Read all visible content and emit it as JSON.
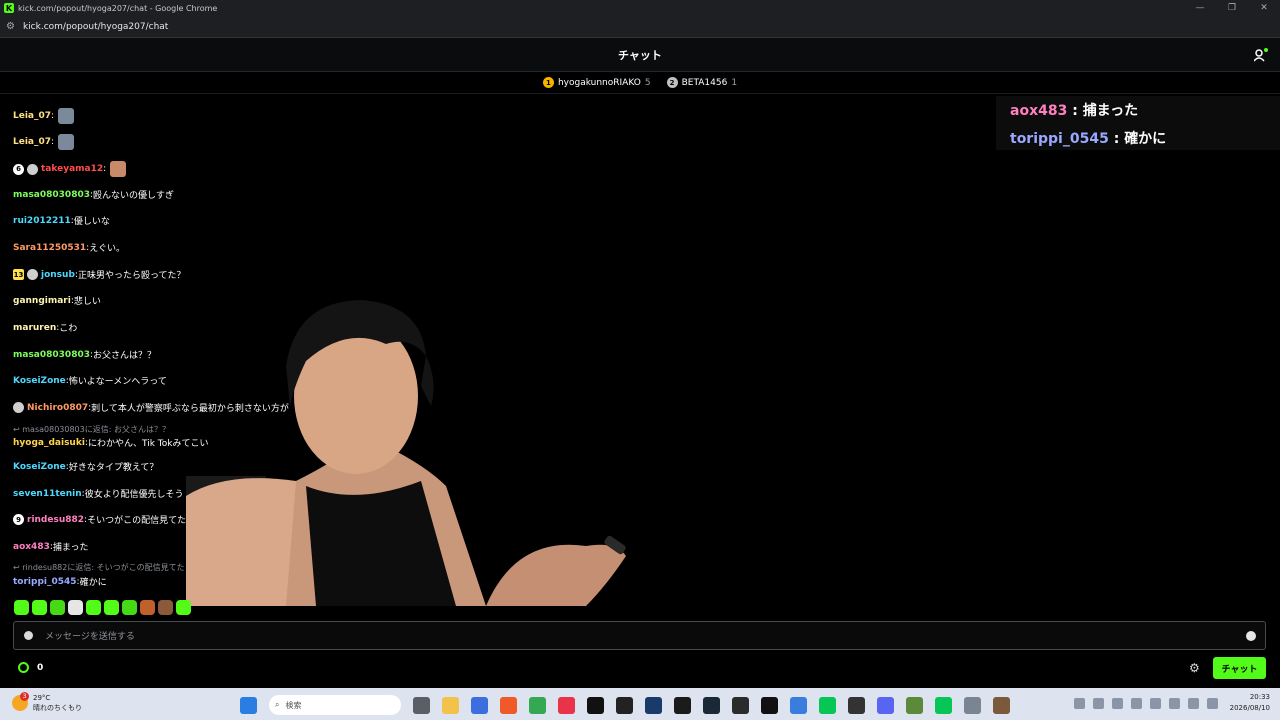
{
  "window": {
    "title": "kick.com/popout/hyoga207/chat - Google Chrome",
    "favicon": "K",
    "controls": [
      "—",
      "❐",
      "✕"
    ]
  },
  "browser": {
    "url": "kick.com/popout/hyoga207/chat"
  },
  "header": {
    "title": "チャット"
  },
  "top_gifters": [
    {
      "name": "hyogakunnoRIAKO",
      "count": "5",
      "color": "#f5b400",
      "medal": "1"
    },
    {
      "name": "BETA1456",
      "count": "1",
      "color": "#c0c0c0",
      "medal": "2"
    }
  ],
  "messages": [
    {
      "user": "Leia_07",
      "color": "#ffe082",
      "text": "",
      "emote": true
    },
    {
      "user": "Leia_07",
      "color": "#ffe082",
      "text": "",
      "emote": true
    },
    {
      "user": "takeyama12",
      "color": "#ff4d4d",
      "text": "",
      "badge": "6",
      "sub": true,
      "emote": true
    },
    {
      "user": "masa08030803",
      "color": "#7cff5a",
      "text": "殴んないの優しすぎ"
    },
    {
      "user": "rui2012211",
      "color": "#4dd9ff",
      "text": "優しいな"
    },
    {
      "user": "Sara11250531",
      "color": "#ff9966",
      "text": "えぐい。"
    },
    {
      "user": "jonsub",
      "color": "#4dd9ff",
      "text": "正味男やったら殴ってた？",
      "badge": "13",
      "badge_square": true,
      "sub": true
    },
    {
      "user": "ganngimari",
      "color": "#fff3b0",
      "text": "悲しい"
    },
    {
      "user": "maruren",
      "color": "#fff3b0",
      "text": "こわ"
    },
    {
      "user": "masa08030803",
      "color": "#7cff5a",
      "text": "お父さんは？？"
    },
    {
      "user": "KoseiZone",
      "color": "#4dd9ff",
      "text": "怖いよなーメンヘラって"
    },
    {
      "user": "Nichiro0807",
      "color": "#ff9966",
      "text": "刺して本人が警察呼ぶなら最初から刺さない方が",
      "sub": true
    },
    {
      "reply": "masa08030803に返信: お父さんは？？",
      "user": "hyoga_daisuki",
      "color": "#ffd54d",
      "text": "にわかやん、Tik Tokみてこい"
    },
    {
      "user": "KoseiZone",
      "color": "#4dd9ff",
      "text": "好きなタイプ教えて？"
    },
    {
      "user": "seven11tenin",
      "color": "#4dd9ff",
      "text": "彼女より配信優先しそう"
    },
    {
      "user": "rindesu882",
      "color": "#ff80c0",
      "text": "そいつがこの配信見てた",
      "badge": "9"
    },
    {
      "user": "aox483",
      "color": "#ff80c0",
      "text": "捕まった"
    },
    {
      "reply": "rindesu882に返信: そいつがこの配信見てた",
      "user": "torippi_0545",
      "color": "#9aa8ff",
      "text": "確かに"
    }
  ],
  "overlay": [
    {
      "user": "aox483",
      "color": "#ff80c0",
      "text": "捕まった"
    },
    {
      "user": "torippi_0545",
      "color": "#9aa8ff",
      "text": "確かに"
    }
  ],
  "input": {
    "placeholder": "メッセージを送信する"
  },
  "footer": {
    "points": "0",
    "send_label": "チャット"
  },
  "taskbar": {
    "weather_badge": "3",
    "temperature": "29°C",
    "weather": "晴れのちくもり",
    "search": "検索",
    "time": "20:33",
    "date": "2026/08/10"
  },
  "colors": {
    "accent": "#53fc18",
    "background": "#000000"
  }
}
